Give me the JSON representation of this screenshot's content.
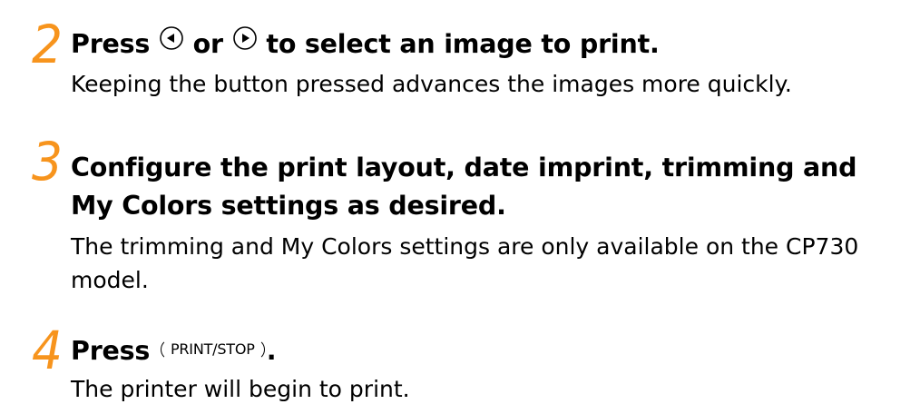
{
  "colors": {
    "step_number": "#F7941D",
    "text": "#000000",
    "background": "#FFFFFF"
  },
  "steps": [
    {
      "number": "2",
      "title_pre": "Press",
      "icon_left": "left-arrow-button-icon",
      "title_mid": "or",
      "icon_right": "right-arrow-button-icon",
      "title_post": "to select an image to print.",
      "description": "Keeping the button pressed advances the images more quickly."
    },
    {
      "number": "3",
      "title_line1": "Configure the print layout, date imprint, trimming and",
      "title_line2": "My Colors settings as desired.",
      "description_line1": "The trimming and My Colors settings are only available on the CP730",
      "description_line2": "model."
    },
    {
      "number": "4",
      "title_pre": "Press",
      "button_label": "PRINT/STOP",
      "title_post": ".",
      "description": "The printer will begin to print."
    }
  ]
}
